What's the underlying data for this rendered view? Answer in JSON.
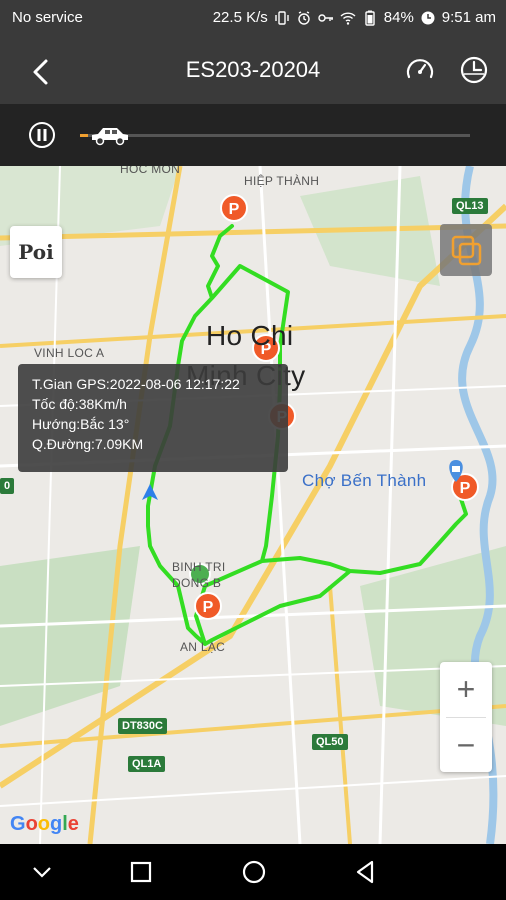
{
  "status_bar": {
    "carrier": "No service",
    "speed": "22.5 K/s",
    "battery": "84%",
    "time": "9:51 am"
  },
  "header": {
    "title": "ES203-20204",
    "icons": [
      "back-arrow-icon",
      "speedometer-icon",
      "clock-history-icon"
    ]
  },
  "playback": {
    "progress": 0.02
  },
  "map": {
    "labels": {
      "hoc_mon": "HOC MON",
      "hiep_thanh": "HIỆP THÀNH",
      "vinh_loc_a": "VINH LOC A",
      "city_line1": "Ho Chi",
      "city_line2": "Minh City",
      "cho_ben_thanh": "Chợ Bến Thành",
      "binh_tri_dong_b_1": "BINH TRI",
      "binh_tri_dong_b_2": "DONG B",
      "an_lac": "AN LẠC",
      "ql13": "QL13",
      "dt830c": "DT830C",
      "ql1a": "QL1A",
      "ql50": "QL50",
      "edge_zero": "0"
    },
    "poi_button": "Poi",
    "zoom_in": "+",
    "zoom_out": "−",
    "google": "Google"
  },
  "info": {
    "line1": "T.Gian GPS:2022-08-06 12:17:22",
    "line2": "Tốc độ:38Km/h",
    "line3": "Hướng:Bắc  13°",
    "line4": "Q.Đường:7.09KM"
  },
  "colors": {
    "route": "#33dd22",
    "parking": "#f05a28",
    "bar": "#3a3a3a"
  }
}
